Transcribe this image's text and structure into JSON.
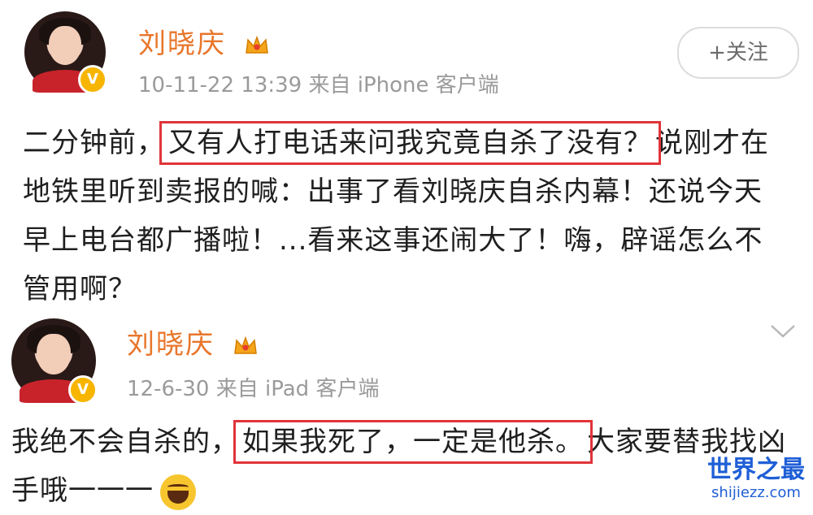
{
  "post1": {
    "username": "刘晓庆",
    "meta": "10-11-22 13:39  来自 iPhone 客户端",
    "follow_label": "+关注",
    "text_before": "二分钟前，",
    "text_highlight": "又有人打电话来问我究竟自杀了没有？",
    "text_after": "说刚才在地铁里听到卖报的喊：出事了看刘晓庆自杀内幕！还说今天早上电台都广播啦！...看来这事还闹大了！嗨，辟谣怎么不管用啊？"
  },
  "post2": {
    "username": "刘晓庆",
    "meta": "12-6-30  来自 iPad 客户端",
    "text_before": "我绝不会自杀的，",
    "text_highlight": "如果我死了，一定是他杀。",
    "text_after": "大家要替我找凶手哦一一一"
  },
  "watermark": {
    "title": "世界之最",
    "url": "shijiezz.com"
  },
  "icons": {
    "verified": "verified-badge-icon",
    "crown": "crown-icon",
    "chevron": "chevron-down-icon",
    "emoji": "laughing-emoji-icon"
  },
  "colors": {
    "username": "#e8762b",
    "highlight_border": "#e0343a",
    "verified": "#f7b500",
    "watermark": "#1f5fd6"
  }
}
